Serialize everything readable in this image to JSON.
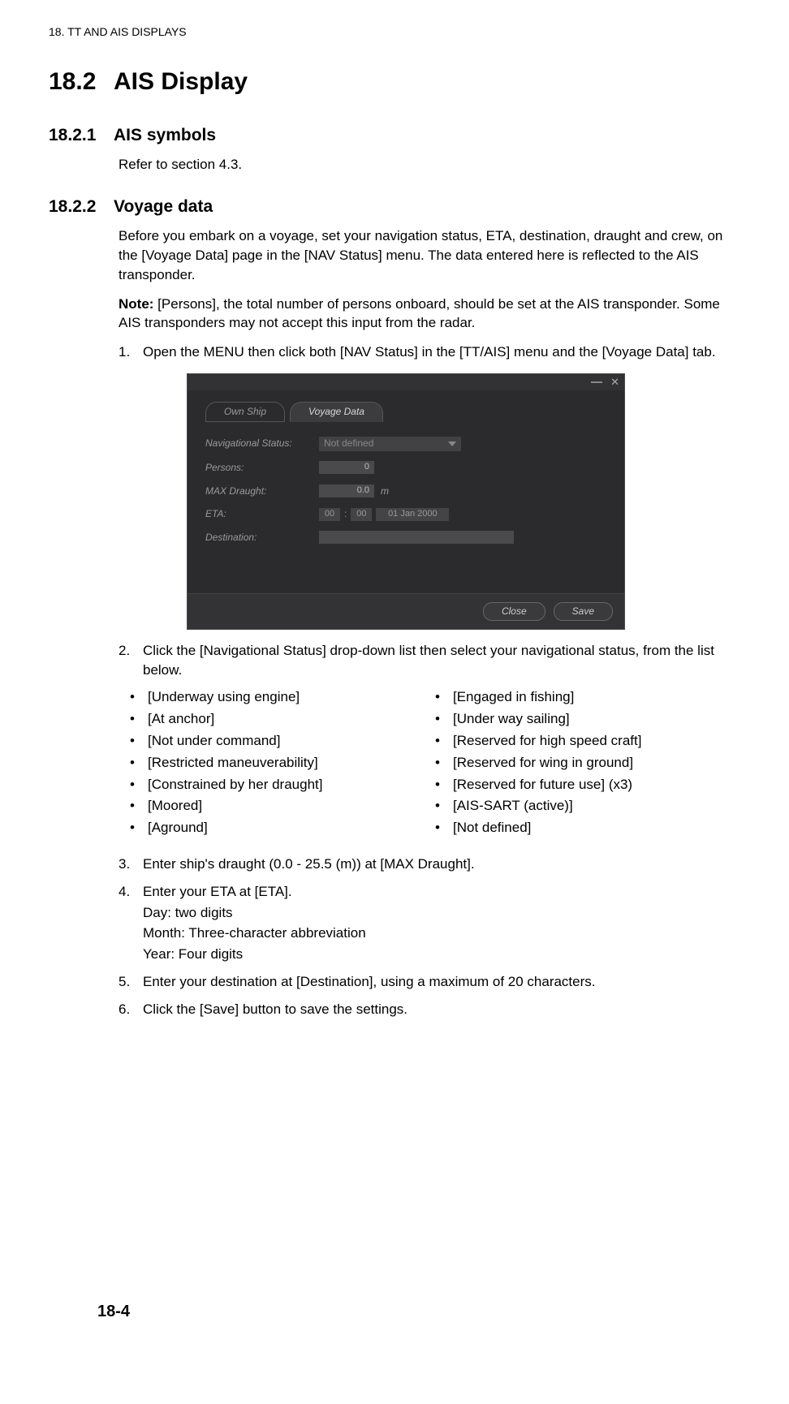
{
  "header": {
    "chapter": "18.  TT AND AIS DISPLAYS"
  },
  "section": {
    "num": "18.2",
    "title": "AIS Display"
  },
  "sub1": {
    "num": "18.2.1",
    "title": "AIS symbols",
    "body": "Refer to section 4.3."
  },
  "sub2": {
    "num": "18.2.2",
    "title": "Voyage data",
    "intro": "Before you embark on a voyage, set your navigation status, ETA, destination, draught and crew, on the [Voyage Data] page in the [NAV Status] menu. The data entered here is reflected to the AIS transponder.",
    "note_label": "Note:",
    "note_text": " [Persons], the total number of persons onboard, should be set at the AIS transponder. Some AIS transponders may not accept this input from the radar.",
    "steps": [
      {
        "n": "1.",
        "t": "Open the MENU then click both [NAV Status] in the [TT/AIS] menu and the [Voyage Data] tab."
      },
      {
        "n": "2.",
        "t": "Click the [Navigational Status] drop-down list then select your navigational status, from the list below."
      },
      {
        "n": "3.",
        "t": "Enter ship's draught (0.0 - 25.5 (m)) at [MAX Draught]."
      },
      {
        "n": "4.",
        "t": "Enter your ETA at [ETA].",
        "sub": [
          "Day: two digits",
          "Month: Three-character abbreviation",
          "Year: Four digits"
        ]
      },
      {
        "n": "5.",
        "t": "Enter your destination at [Destination], using a maximum of 20 characters."
      },
      {
        "n": "6.",
        "t": "Click the [Save] button to save the settings."
      }
    ],
    "bullets_left": [
      "[Underway using engine]",
      "[At anchor]",
      "[Not under command]",
      "[Restricted maneuverability]",
      "[Constrained by her draught]",
      "[Moored]",
      "[Aground]"
    ],
    "bullets_right": [
      "[Engaged in fishing]",
      "[Under way sailing]",
      "[Reserved for high speed craft]",
      "[Reserved for wing in ground]",
      "[Reserved for future use] (x3)",
      "[AIS-SART (active)]",
      "[Not defined]"
    ]
  },
  "ui": {
    "tabs": {
      "own_ship": "Own Ship",
      "voyage_data": "Voyage Data"
    },
    "labels": {
      "nav_status": "Navigational Status:",
      "persons": "Persons:",
      "max_draught": "MAX Draught:",
      "eta": "ETA:",
      "destination": "Destination:"
    },
    "values": {
      "nav_status": "Not defined",
      "persons": "0",
      "max_draught": "0.0",
      "draught_unit": "m",
      "eta_hh": "00",
      "eta_mm": "00",
      "eta_date": "01 Jan 2000"
    },
    "buttons": {
      "close": "Close",
      "save": "Save"
    }
  },
  "page_number": "18-4"
}
